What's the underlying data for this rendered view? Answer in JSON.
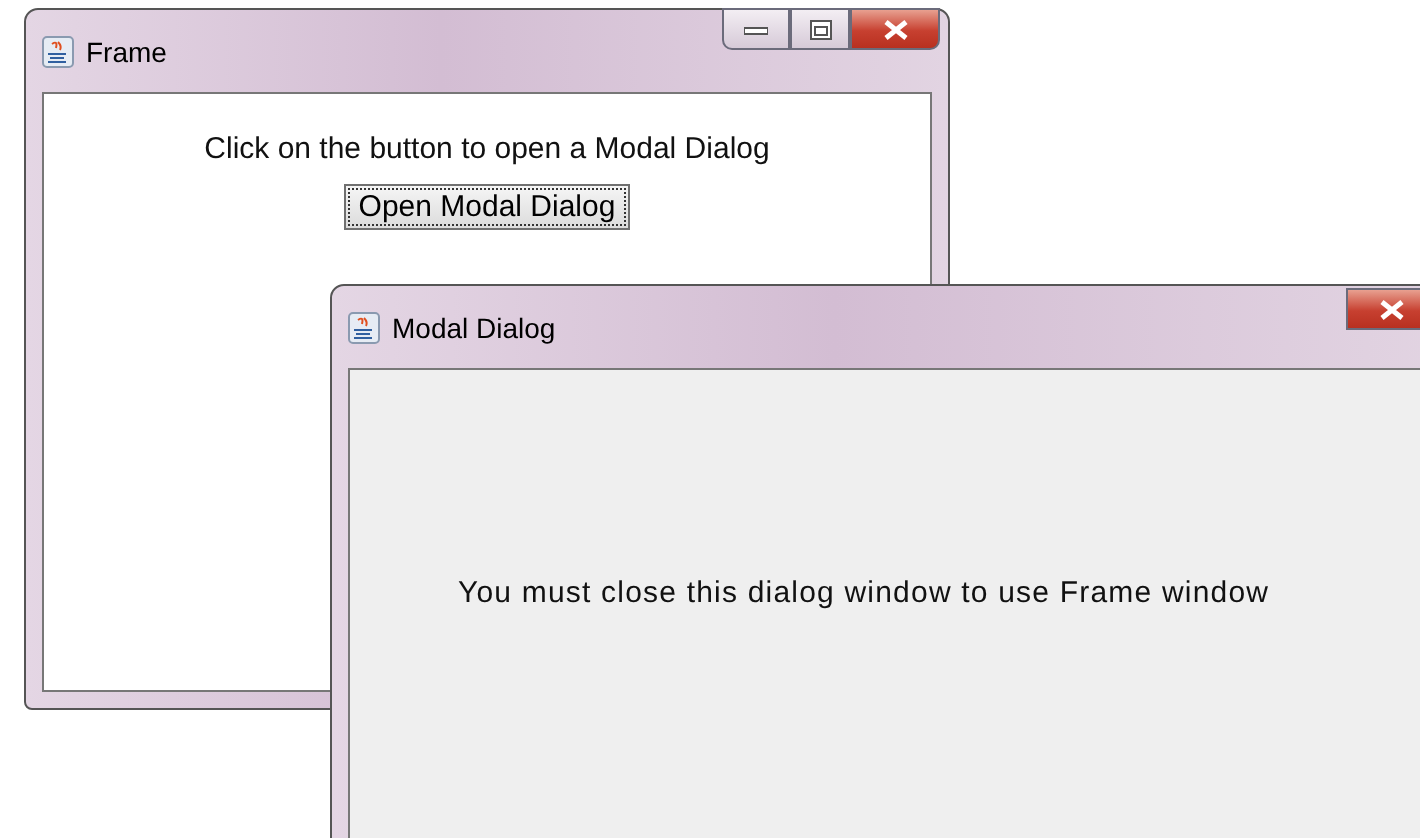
{
  "frame": {
    "title": "Frame",
    "label": "Click on the button to open a Modal Dialog",
    "button": "Open Modal Dialog"
  },
  "dialog": {
    "title": "Modal Dialog",
    "message": "You must close this dialog window to use Frame window"
  }
}
